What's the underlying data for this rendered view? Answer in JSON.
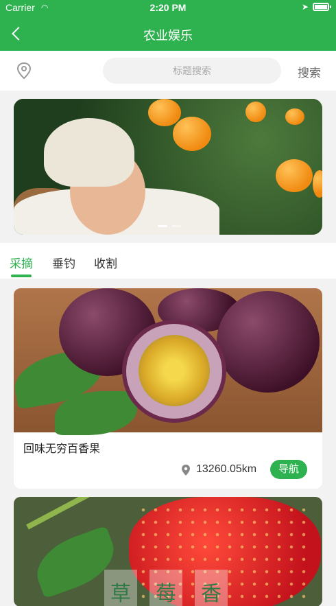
{
  "status_bar": {
    "carrier": "Carrier",
    "time": "2:20 PM"
  },
  "header": {
    "title": "农业娱乐"
  },
  "search": {
    "placeholder": "标题搜索",
    "button_label": "搜索"
  },
  "tabs": [
    {
      "label": "采摘",
      "active": true
    },
    {
      "label": "垂钓",
      "active": false
    },
    {
      "label": "收割",
      "active": false
    }
  ],
  "cards": [
    {
      "title": "回味无穷百香果",
      "distance": "13260.05km",
      "nav_label": "导航"
    }
  ],
  "card2_overlay": [
    "草",
    "莓",
    "香"
  ],
  "colors": {
    "accent": "#2eb24f"
  }
}
